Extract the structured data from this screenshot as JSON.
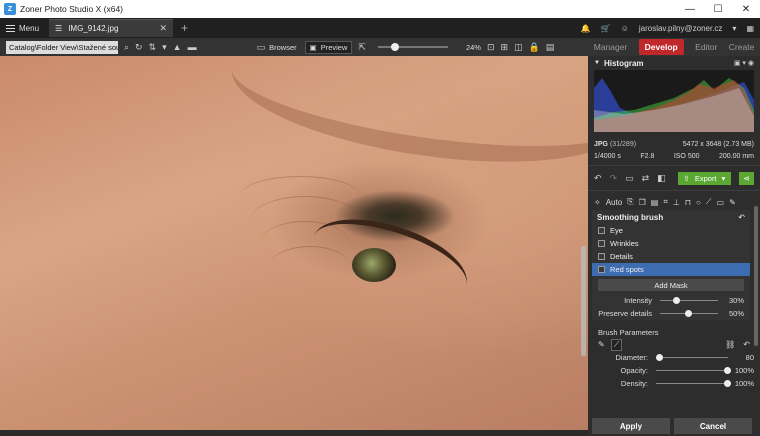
{
  "window": {
    "title": "Zoner Photo Studio X (x64)",
    "minimize": "—",
    "maximize": "☐",
    "close": "✕"
  },
  "tabbar": {
    "menu_label": "Menu",
    "doc_tab": "IMG_9142.jpg",
    "user": "jaroslav.pilny@zoner.cz"
  },
  "toolbar": {
    "path": "Catalog\\Folder View\\Stažené soubo",
    "browser_label": "Browser",
    "preview_label": "Preview",
    "zoom": "24%",
    "zoom_level": 0.24
  },
  "modules": {
    "manager": "Manager",
    "develop": "Develop",
    "editor": "Editor",
    "create": "Create"
  },
  "histogram": {
    "title": "Histogram",
    "format": "JPG",
    "index": "(31/289)",
    "dimensions": "5472 x 3648 (2.73 MB)",
    "shutter": "1/4000 s",
    "aperture": "F2.8",
    "iso": "ISO 500",
    "focal": "200.00 mm"
  },
  "actions": {
    "export_label": "Export"
  },
  "tools": {
    "auto_label": "Auto"
  },
  "smoothing": {
    "title": "Smoothing brush",
    "masks": [
      {
        "label": "Eye",
        "selected": false
      },
      {
        "label": "Wrinkles",
        "selected": false
      },
      {
        "label": "Details",
        "selected": false
      },
      {
        "label": "Red spots",
        "selected": true
      }
    ],
    "add_mask": "Add Mask",
    "intensity": {
      "label": "Intensity",
      "value": "30%",
      "level": 0.3
    },
    "preserve": {
      "label": "Preserve details",
      "value": "50%",
      "level": 0.5
    }
  },
  "brush": {
    "title": "Brush Parameters",
    "diameter": {
      "label": "Diameter:",
      "value": "80",
      "level": 0.05
    },
    "opacity": {
      "label": "Opacity:",
      "value": "100%",
      "level": 1.0
    },
    "density": {
      "label": "Density:",
      "value": "100%",
      "level": 1.0
    }
  },
  "footer": {
    "apply": "Apply",
    "cancel": "Cancel"
  },
  "colors": {
    "accent_red": "#c0282b",
    "export_green": "#5aa832",
    "selection_blue": "#3d6db0"
  }
}
